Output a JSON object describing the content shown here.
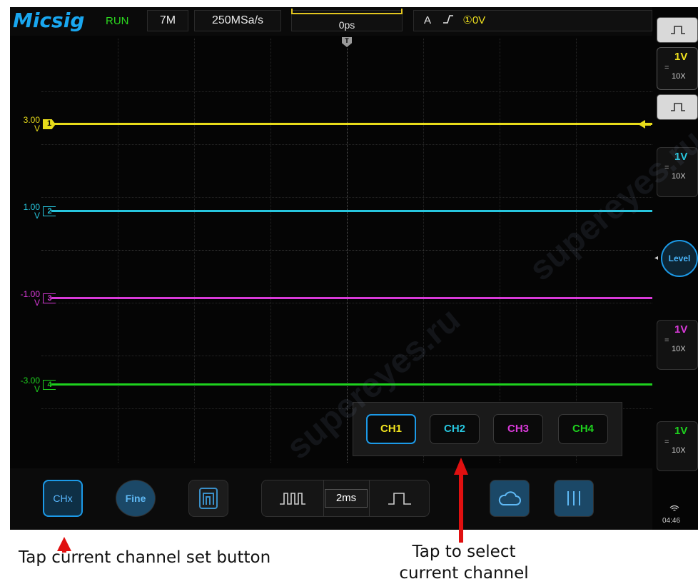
{
  "brand": {
    "logo": "Micsig",
    "run_state": "RUN"
  },
  "header": {
    "memory_depth": "7M",
    "sample_rate": "250MSa/s",
    "delay": "0ps",
    "trigger_mode": "A",
    "trigger_edge_symbol": "⌐",
    "trigger_source": "①",
    "trigger_level": "0V",
    "trigger_marker": "T"
  },
  "channels": [
    {
      "id": "1",
      "offset_label": "3.00",
      "unit": "V",
      "color": "#e8dc1a"
    },
    {
      "id": "2",
      "offset_label": "1.00",
      "unit": "V",
      "color": "#27c6de"
    },
    {
      "id": "3",
      "offset_label": "-1.00",
      "unit": "V",
      "color": "#d93ad9"
    },
    {
      "id": "4",
      "offset_label": "-3.00",
      "unit": "V",
      "color": "#1ed21e"
    }
  ],
  "side_panel": {
    "cards": [
      {
        "volts": "1V",
        "coupling": "=",
        "probe": "10X",
        "color": "#f0e21e"
      },
      {
        "volts": "1V",
        "coupling": "=",
        "probe": "10X",
        "color": "#27c6de"
      },
      {
        "volts": "1V",
        "coupling": "=",
        "probe": "10X",
        "color": "#d93ad9"
      },
      {
        "volts": "1V",
        "coupling": "=",
        "probe": "10X",
        "color": "#1ed21e"
      }
    ],
    "level_label": "Level",
    "time": "04:46"
  },
  "channel_selector": {
    "buttons": [
      {
        "label": "CH1",
        "color": "#f0e21e",
        "active": true
      },
      {
        "label": "CH2",
        "color": "#27c6de",
        "active": false
      },
      {
        "label": "CH3",
        "color": "#d93ad9",
        "active": false
      },
      {
        "label": "CH4",
        "color": "#1ed21e",
        "active": false
      }
    ]
  },
  "toolbar": {
    "chx_label": "CHx",
    "fine_label": "Fine",
    "timebase": "2ms"
  },
  "annotations": {
    "left": "Tap current channel set button",
    "right_line1": "Tap to select",
    "right_line2": "current channel"
  },
  "watermark": {
    "text": "supereyes.ru"
  }
}
